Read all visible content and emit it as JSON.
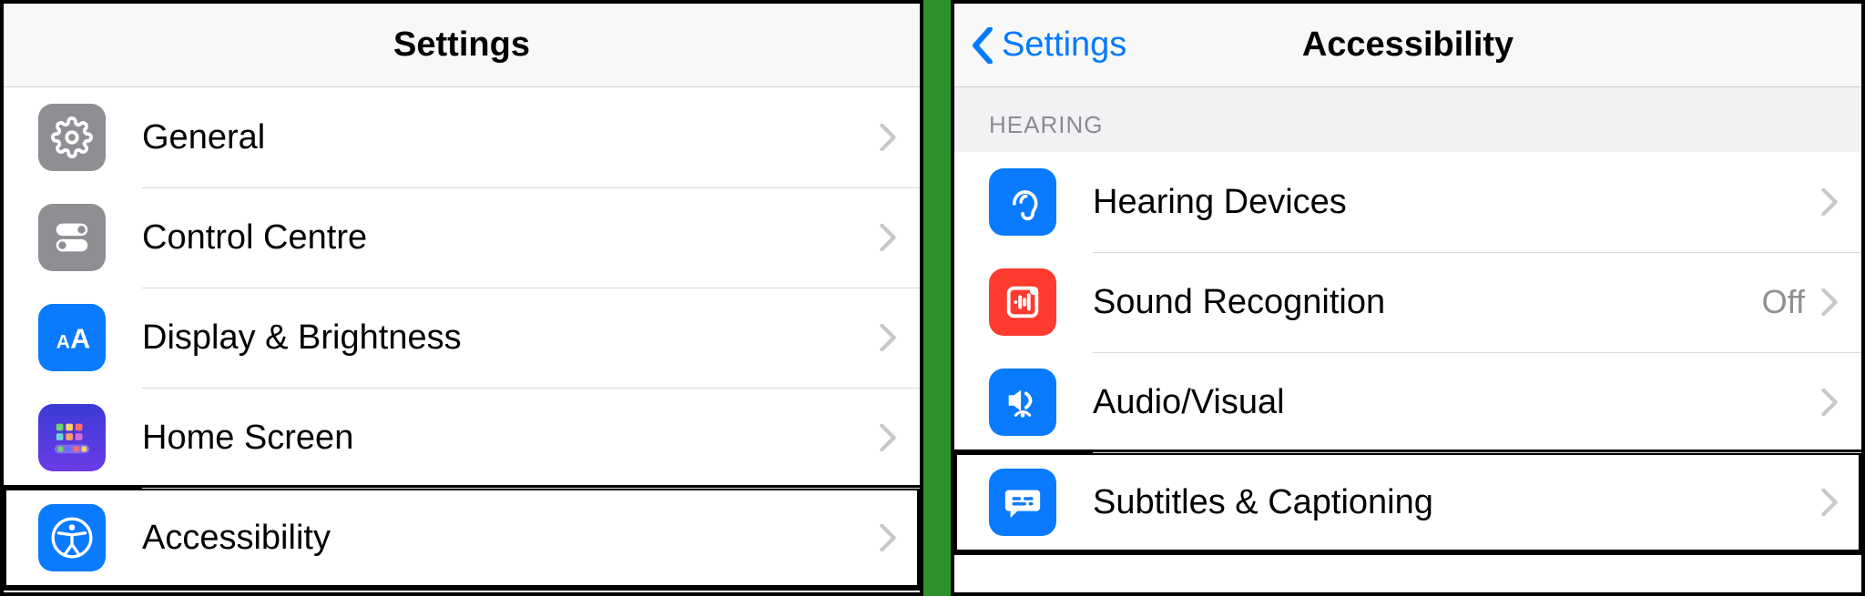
{
  "left": {
    "title": "Settings",
    "items": [
      {
        "label": "General"
      },
      {
        "label": "Control Centre"
      },
      {
        "label": "Display & Brightness"
      },
      {
        "label": "Home Screen"
      },
      {
        "label": "Accessibility"
      }
    ]
  },
  "right": {
    "back_label": "Settings",
    "title": "Accessibility",
    "section_header": "Hearing",
    "items": [
      {
        "label": "Hearing Devices",
        "detail": ""
      },
      {
        "label": "Sound Recognition",
        "detail": "Off"
      },
      {
        "label": "Audio/Visual",
        "detail": ""
      },
      {
        "label": "Subtitles & Captioning",
        "detail": ""
      }
    ]
  }
}
